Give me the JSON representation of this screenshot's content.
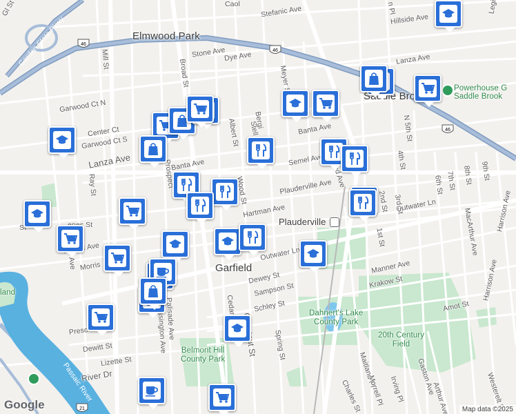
{
  "map": {
    "places": {
      "elmwood_park": "Elmwood Park",
      "saddle_brook": "Saddle Brook",
      "plauderville": "Plauderville",
      "garfield": "Garfield",
      "powerhouse_gym": "Powerhouse G",
      "powerhouse_gym_line2": "Saddle Brook",
      "belmont_hill_park": "Belmont Hill\nCounty Park",
      "dahnerts_lake": "Dahnert's Lake\nCounty Park",
      "twentieth_century": "20th Century\nField",
      "passaic_river": "Passaic River",
      "land": "land",
      "garden_state_pkwy": "Garden State Pkwy"
    },
    "streets": [
      "Stefanic Ave",
      "Hillside Ave",
      "Stone Ave",
      "Dye Ave",
      "Lanza Ave",
      "Garwood Ct N",
      "Center Ct",
      "Garwood Ct S",
      "Lanza Ave",
      "Banta Ave",
      "Banta Ave",
      "Semel Ave",
      "Plauderville Ave",
      "Hartman Ave",
      "Outwater Ln",
      "Outwater Ln",
      "Dewey St",
      "Sampson St",
      "Krakow St",
      "Manner Ave",
      "Schley St",
      "Amot St",
      "Dewitt St",
      "Lizette St",
      "Presc",
      "River Dr",
      "Mill St",
      "Ray St",
      "Albert St",
      "Stell",
      "Wood St",
      "Meyer St",
      "Bergi",
      "Palisade Ave",
      "Lessington Ave",
      "Cedar",
      "Chestnut St",
      "Spring St",
      "Maitland Pl",
      "Morrell Pl",
      "Irving Pl",
      "Gaston Ave",
      "Charles St",
      "Arthur Ave",
      "Westerelt Pl",
      "1st St",
      "2nd St",
      "3rd St",
      "4th St",
      "N 5th St",
      "6th St",
      "7th St",
      "8th St",
      "9th St",
      "MacArthur Ave",
      "Harrison Ave",
      "Harrison Ave",
      "Pacific Ave",
      "Morris",
      "Prospect",
      "Caol",
      "Legi",
      "Broad St",
      "land Ave",
      "n Pl",
      "St",
      "enes St",
      "ynn Ave",
      "Gl St"
    ],
    "shields": [
      "46",
      "46",
      "46",
      "21"
    ],
    "brand": "Google",
    "attribution": "Map data ©2025",
    "pins": {
      "school": "school-icon",
      "shop": "shopping-bag-icon",
      "cart": "shopping-cart-icon",
      "food": "restaurant-icon",
      "cafe": "cafe-icon"
    },
    "colors": {
      "pin": "#2a6fd8",
      "highway": "#8aa5c6",
      "water": "#59b1e0",
      "park": "#c9e8cf",
      "road": "#ffffff",
      "bg": "#f3f1ee"
    }
  }
}
